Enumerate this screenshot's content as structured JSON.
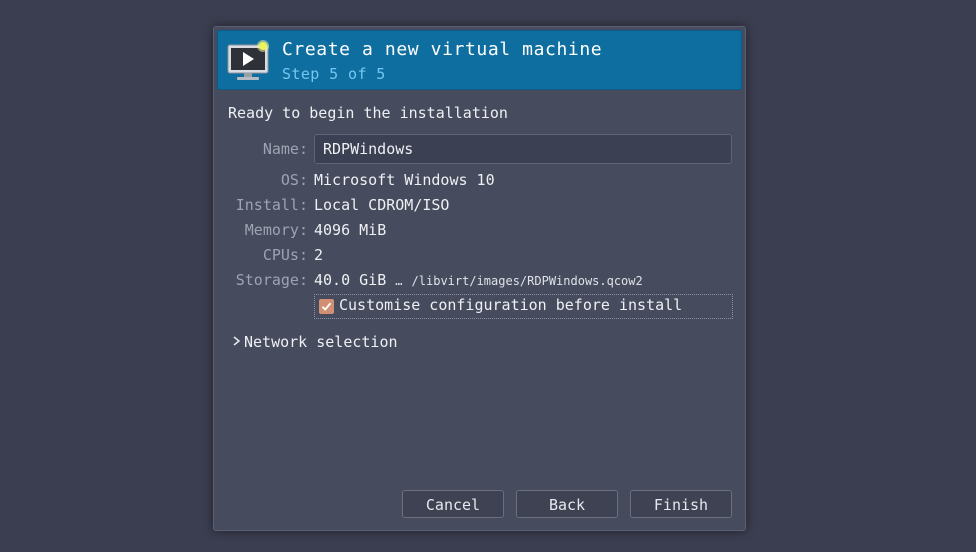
{
  "header": {
    "title": "Create a new virtual machine",
    "subtitle": "Step 5 of 5",
    "icon": "monitor-play-icon"
  },
  "summary": {
    "heading": "Ready to begin the installation",
    "name_label": "Name:",
    "name_value": "RDPWindows",
    "os_label": "OS:",
    "os_value": "Microsoft Windows 10",
    "install_label": "Install:",
    "install_value": "Local CDROM/ISO",
    "memory_label": "Memory:",
    "memory_value": "4096 MiB",
    "cpus_label": "CPUs:",
    "cpus_value": "2",
    "storage_label": "Storage:",
    "storage_size": "40.0 GiB",
    "storage_ellipsis": "…",
    "storage_path": "/libvirt/images/RDPWindows.qcow2"
  },
  "customise": {
    "label": "Customise configuration before install",
    "checked": true
  },
  "network": {
    "label": "Network selection",
    "expanded": false
  },
  "buttons": {
    "cancel": "Cancel",
    "back": "Back",
    "finish": "Finish"
  },
  "colors": {
    "background": "#3b3e50",
    "dialog": "#464b5d",
    "header": "#0f6ea0",
    "subtitle": "#74c7f2",
    "checkbox": "#d38f73"
  }
}
